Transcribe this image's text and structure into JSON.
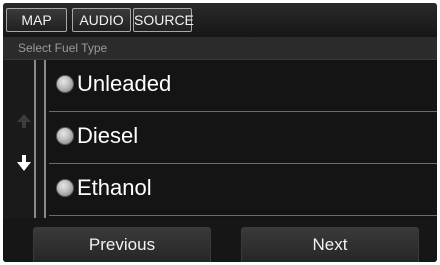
{
  "tabs": {
    "map": "MAP",
    "audio": "AUDIO",
    "source": "SOURCE"
  },
  "screen_title": "Select Fuel Type",
  "fuel_options": [
    {
      "label": "Unleaded"
    },
    {
      "label": "Diesel"
    },
    {
      "label": "Ethanol"
    }
  ],
  "nav": {
    "previous": "Previous",
    "next": "Next"
  },
  "colors": {
    "background": "#1c1c1c",
    "text": "#ffffff",
    "muted_text": "#9a9a9a"
  }
}
